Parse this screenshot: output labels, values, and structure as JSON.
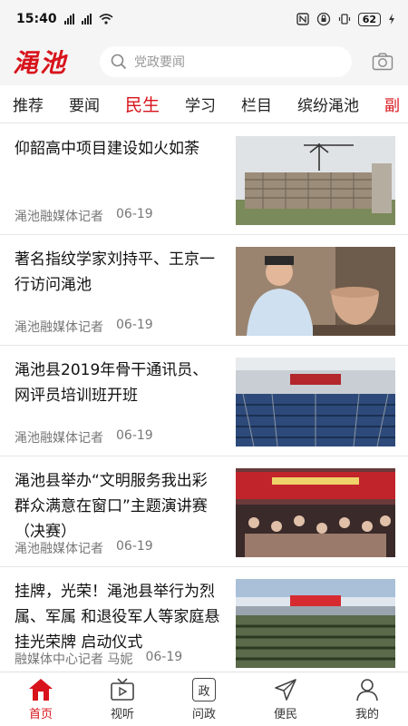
{
  "status": {
    "time": "15:40",
    "battery": "62"
  },
  "header": {
    "logo": "渑池",
    "search_placeholder": "党政要闻"
  },
  "tabs": [
    {
      "label": "推荐",
      "active": false
    },
    {
      "label": "要闻",
      "active": false
    },
    {
      "label": "民生",
      "active": true
    },
    {
      "label": "学习",
      "active": false
    },
    {
      "label": "栏目",
      "active": false
    },
    {
      "label": "缤纷渑池",
      "active": false
    },
    {
      "label": "副",
      "active": false
    }
  ],
  "news": [
    {
      "title": "仰韶高中项目建设如火如荼",
      "source": "渑池融媒体记者",
      "date": "06-19"
    },
    {
      "title": "著名指纹学家刘持平、王京一行访问渑池",
      "source": "渑池融媒体记者",
      "date": "06-19"
    },
    {
      "title": "渑池县2019年骨干通讯员、网评员培训班开班",
      "source": "渑池融媒体记者",
      "date": "06-19"
    },
    {
      "title": "渑池县举办“文明服务我出彩 群众满意在窗口”主题演讲赛（决赛）",
      "source": "渑池融媒体记者",
      "date": "06-19"
    },
    {
      "title": "挂牌，光荣！渑池县举行为烈属、军属 和退役军人等家庭悬挂光荣牌 启动仪式",
      "source": "融媒体中心记者 马妮",
      "date": "06-19"
    }
  ],
  "bottom_nav": [
    {
      "label": "首页",
      "icon": "home-icon",
      "active": true
    },
    {
      "label": "视听",
      "icon": "tv-icon",
      "active": false
    },
    {
      "label": "问政",
      "icon": "zheng-box-icon",
      "icon_text": "政",
      "active": false
    },
    {
      "label": "便民",
      "icon": "send-icon",
      "active": false
    },
    {
      "label": "我的",
      "icon": "user-icon",
      "active": false
    }
  ],
  "colors": {
    "accent": "#d8131b",
    "background": "#f5f5f5"
  }
}
